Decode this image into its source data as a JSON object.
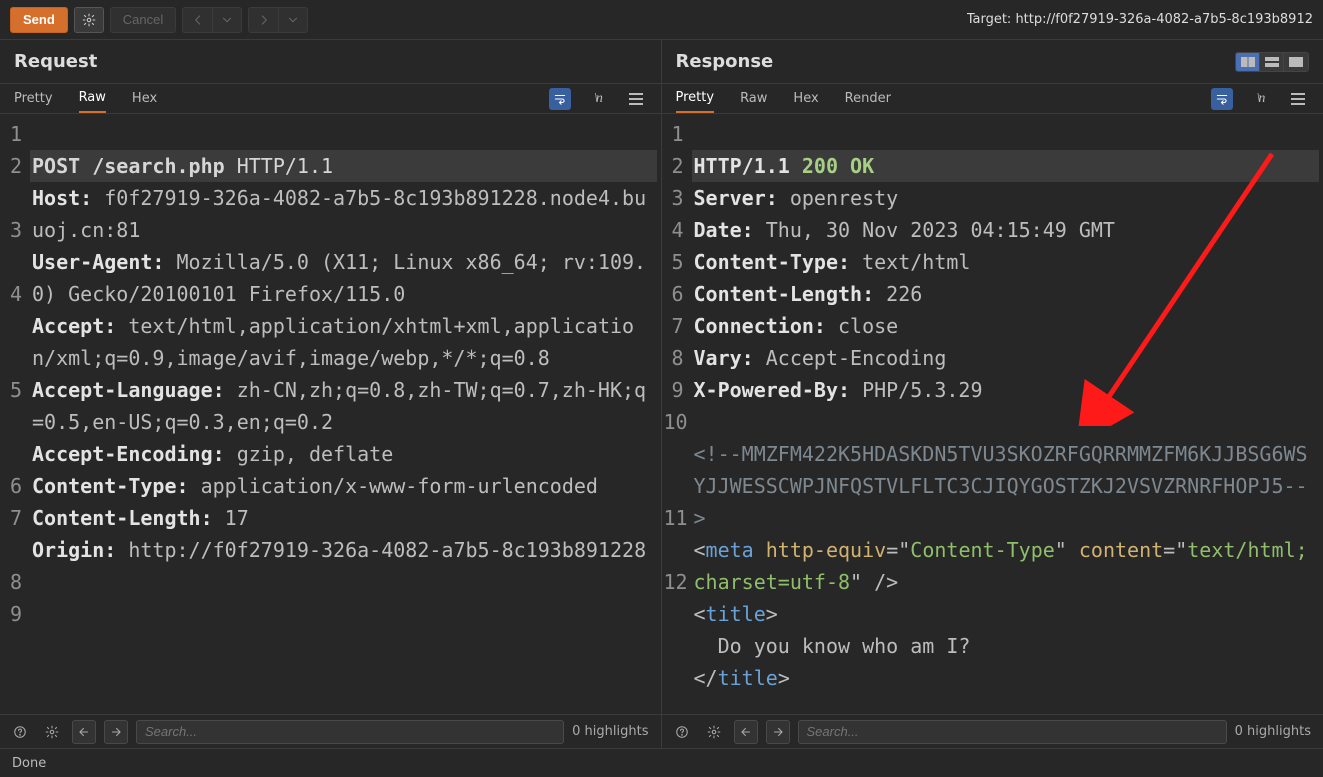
{
  "toolbar": {
    "send_label": "Send",
    "cancel_label": "Cancel",
    "target_label": "Target: ",
    "target_url": "http://f0f27919-326a-4082-a7b5-8c193b8912"
  },
  "request": {
    "title": "Request",
    "tabs": {
      "pretty": "Pretty",
      "raw": "Raw",
      "hex": "Hex"
    },
    "active_tab": "Raw",
    "search_placeholder": "Search...",
    "highlights_label": "0 highlights",
    "lines": {
      "l1": {
        "method": "POST",
        "path": "/search.php",
        "ver": "HTTP/1.1"
      },
      "l2": {
        "name": "Host:",
        "value": "f0f27919-326a-4082-a7b5-8c193b891228.node4.buuoj.cn:81"
      },
      "l3": {
        "name": "User-Agent:",
        "value": "Mozilla/5.0 (X11; Linux x86_64; rv:109.0) Gecko/20100101 Firefox/115.0"
      },
      "l4": {
        "name": "Accept:",
        "value": "text/html,application/xhtml+xml,application/xml;q=0.9,image/avif,image/webp,*/*;q=0.8"
      },
      "l5": {
        "name": "Accept-Language:",
        "value": "zh-CN,zh;q=0.8,zh-TW;q=0.7,zh-HK;q=0.5,en-US;q=0.3,en;q=0.2"
      },
      "l6": {
        "name": "Accept-Encoding:",
        "value": "gzip, deflate"
      },
      "l7": {
        "name": "Content-Type:",
        "value": "application/x-www-form-urlencoded"
      },
      "l8": {
        "name": "Content-Length:",
        "value": "17"
      },
      "l9": {
        "name": "Origin:",
        "value": "http://f0f27919-326a-4082-a7b5-8c193b891228"
      }
    },
    "line_numbers": {
      "n1": "1",
      "n2": "2",
      "n3": "3",
      "n4": "4",
      "n5": "5",
      "n6": "6",
      "n7": "7",
      "n8": "8",
      "n9": "9"
    }
  },
  "response": {
    "title": "Response",
    "tabs": {
      "pretty": "Pretty",
      "raw": "Raw",
      "hex": "Hex",
      "render": "Render"
    },
    "active_tab": "Pretty",
    "search_placeholder": "Search...",
    "highlights_label": "0 highlights",
    "lines": {
      "l1": {
        "ver": "HTTP/1.1",
        "status_code": "200",
        "status_text": "OK"
      },
      "l2": {
        "name": "Server:",
        "value": "openresty"
      },
      "l3": {
        "name": "Date:",
        "value": "Thu, 30 Nov 2023 04:15:49 GMT"
      },
      "l4": {
        "name": "Content-Type:",
        "value": "text/html"
      },
      "l5": {
        "name": "Content-Length:",
        "value": "226"
      },
      "l6": {
        "name": "Connection:",
        "value": "close"
      },
      "l7": {
        "name": "Vary:",
        "value": "Accept-Encoding"
      },
      "l8": {
        "name": "X-Powered-By:",
        "value": "PHP/5.3.29"
      },
      "l10": {
        "comment": "<!--MMZFM422K5HDASKDN5TVU3SKOZRFGQRRMMZFM6KJJBSG6WSYJJWESSCWPJNFQSTVLFLTC3CJIQYGOSTZKJ2VSVZRNRFHOPJ5-->"
      },
      "l11": {
        "pre": "<",
        "tag1": "meta",
        "sp1": " ",
        "attr1": "http-equiv",
        "eq1": "=",
        "q1a": "\"",
        "val1": "Content-Type",
        "q1b": "\"",
        "sp2": " ",
        "attr2": "content",
        "eq2": "=",
        "q2a": "\"",
        "val2": "text/html; charset=utf-8",
        "q2b": "\"",
        "end": " />"
      },
      "l12": {
        "open_pre": "<",
        "open_tag": "title",
        "open_post": ">",
        "text": "  Do you know who am I?",
        "close_pre": "</",
        "close_tag": "title",
        "close_post": ">"
      }
    },
    "line_numbers": {
      "n1": "1",
      "n2": "2",
      "n3": "3",
      "n4": "4",
      "n5": "5",
      "n6": "6",
      "n7": "7",
      "n8": "8",
      "n9": "9",
      "n10": "10",
      "n11": "11",
      "n12": "12"
    }
  },
  "status": {
    "text": "Done"
  }
}
